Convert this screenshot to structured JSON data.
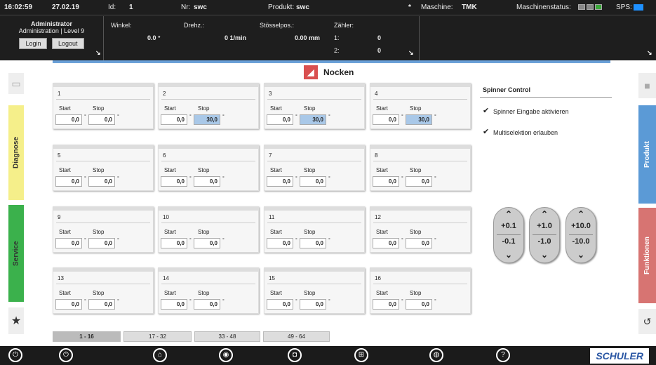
{
  "header": {
    "time": "16:02:59",
    "date": "27.02.19",
    "id_label": "Id:",
    "id_value": "1",
    "nr_label": "Nr:",
    "nr_value": "swc",
    "produkt_label": "Produkt:",
    "produkt_value": "swc",
    "star": "*",
    "maschine_label": "Maschine:",
    "maschine_value": "TMK",
    "maschinenstatus_label": "Maschinenstatus:",
    "sps_label": "SPS:"
  },
  "user": {
    "name": "Administrator",
    "role": "Administration | Level 9",
    "login": "Login",
    "logout": "Logout"
  },
  "values": {
    "winkel_label": "Winkel:",
    "winkel_value": "0.0 °",
    "drehz_label": "Drehz.:",
    "drehz_value": "0 1/min",
    "stoessel_label": "Stösselpos.:",
    "stoessel_value": "0.00 mm",
    "zaehler_label": "Zähler:",
    "z1_label": "1:",
    "z1_value": "0",
    "z2_label": "2:",
    "z2_value": "0"
  },
  "sidebar": {
    "diagnose": "Diagnose",
    "service": "Service",
    "produkt": "Produkt",
    "funktionen": "Funktionen"
  },
  "page_title": "Nocken",
  "cams": [
    {
      "num": "1",
      "start_label": "Start",
      "stop_label": "Stop",
      "start": "0,0",
      "stop": "0,0",
      "deg": "°"
    },
    {
      "num": "2",
      "start_label": "Start",
      "stop_label": "Stop",
      "start": "0,0",
      "stop": "30,0",
      "deg": "°"
    },
    {
      "num": "3",
      "start_label": "Start",
      "stop_label": "Stop",
      "start": "0,0",
      "stop": "30,0",
      "deg": "°"
    },
    {
      "num": "4",
      "start_label": "Start",
      "stop_label": "Stop",
      "start": "0,0",
      "stop": "30,0",
      "deg": "°"
    },
    {
      "num": "5",
      "start_label": "Start",
      "stop_label": "Stop",
      "start": "0,0",
      "stop": "0,0",
      "deg": "°"
    },
    {
      "num": "6",
      "start_label": "Start",
      "stop_label": "Stop",
      "start": "0,0",
      "stop": "0,0",
      "deg": "°"
    },
    {
      "num": "7",
      "start_label": "Start",
      "stop_label": "Stop",
      "start": "0,0",
      "stop": "0,0",
      "deg": "°"
    },
    {
      "num": "8",
      "start_label": "Start",
      "stop_label": "Stop",
      "start": "0,0",
      "stop": "0,0",
      "deg": "°"
    },
    {
      "num": "9",
      "start_label": "Start",
      "stop_label": "Stop",
      "start": "0,0",
      "stop": "0,0",
      "deg": "°"
    },
    {
      "num": "10",
      "start_label": "Start",
      "stop_label": "Stop",
      "start": "0,0",
      "stop": "0,0",
      "deg": "°"
    },
    {
      "num": "11",
      "start_label": "Start",
      "stop_label": "Stop",
      "start": "0,0",
      "stop": "0,0",
      "deg": "°"
    },
    {
      "num": "12",
      "start_label": "Start",
      "stop_label": "Stop",
      "start": "0,0",
      "stop": "0,0",
      "deg": "°"
    },
    {
      "num": "13",
      "start_label": "Start",
      "stop_label": "Stop",
      "start": "0,0",
      "stop": "0,0",
      "deg": "°"
    },
    {
      "num": "14",
      "start_label": "Start",
      "stop_label": "Stop",
      "start": "0,0",
      "stop": "0,0",
      "deg": "°"
    },
    {
      "num": "15",
      "start_label": "Start",
      "stop_label": "Stop",
      "start": "0,0",
      "stop": "0,0",
      "deg": "°"
    },
    {
      "num": "16",
      "start_label": "Start",
      "stop_label": "Stop",
      "start": "0,0",
      "stop": "0,0",
      "deg": "°"
    }
  ],
  "spinner": {
    "title": "Spinner Control",
    "opt1": "Spinner Eingabe aktivieren",
    "opt2": "Multiselektion erlauben",
    "buttons": [
      {
        "plus": "+0.1",
        "minus": "-0.1"
      },
      {
        "plus": "+1.0",
        "minus": "-1.0"
      },
      {
        "plus": "+10.0",
        "minus": "-10.0"
      }
    ]
  },
  "pages": [
    "1 - 16",
    "17 - 32",
    "33 - 48",
    "49 - 64"
  ],
  "logo": "SCHULER"
}
